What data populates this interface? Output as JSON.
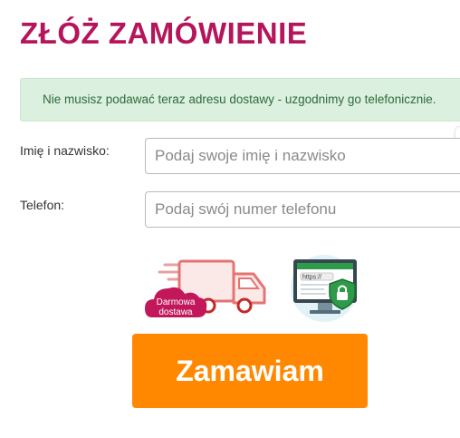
{
  "page": {
    "title": "ZŁÓŻ ZAMÓWIENIE"
  },
  "notice": {
    "text": "Nie musisz podawać teraz adresu dostawy - uzgodnimy go telefonicznie."
  },
  "form": {
    "name": {
      "label": "Imię i nazwisko:",
      "placeholder": "Podaj swoje imię i nazwisko",
      "value": ""
    },
    "phone": {
      "label": "Telefon:",
      "placeholder": "Podaj swój numer telefonu",
      "value": ""
    }
  },
  "badges": {
    "free_delivery": {
      "icon": "delivery-truck-icon",
      "line1": "Darmowa",
      "line2": "dostawa"
    },
    "secure": {
      "icon": "secure-https-icon",
      "url_text": "https://"
    }
  },
  "submit": {
    "label": "Zamawiam"
  },
  "colors": {
    "title": "#b5155a",
    "notice_bg": "#dbf0df",
    "notice_text": "#2e6b3a",
    "button": "#ff8800",
    "badge_cloud": "#c2185b",
    "shield": "#2e9b4a"
  }
}
